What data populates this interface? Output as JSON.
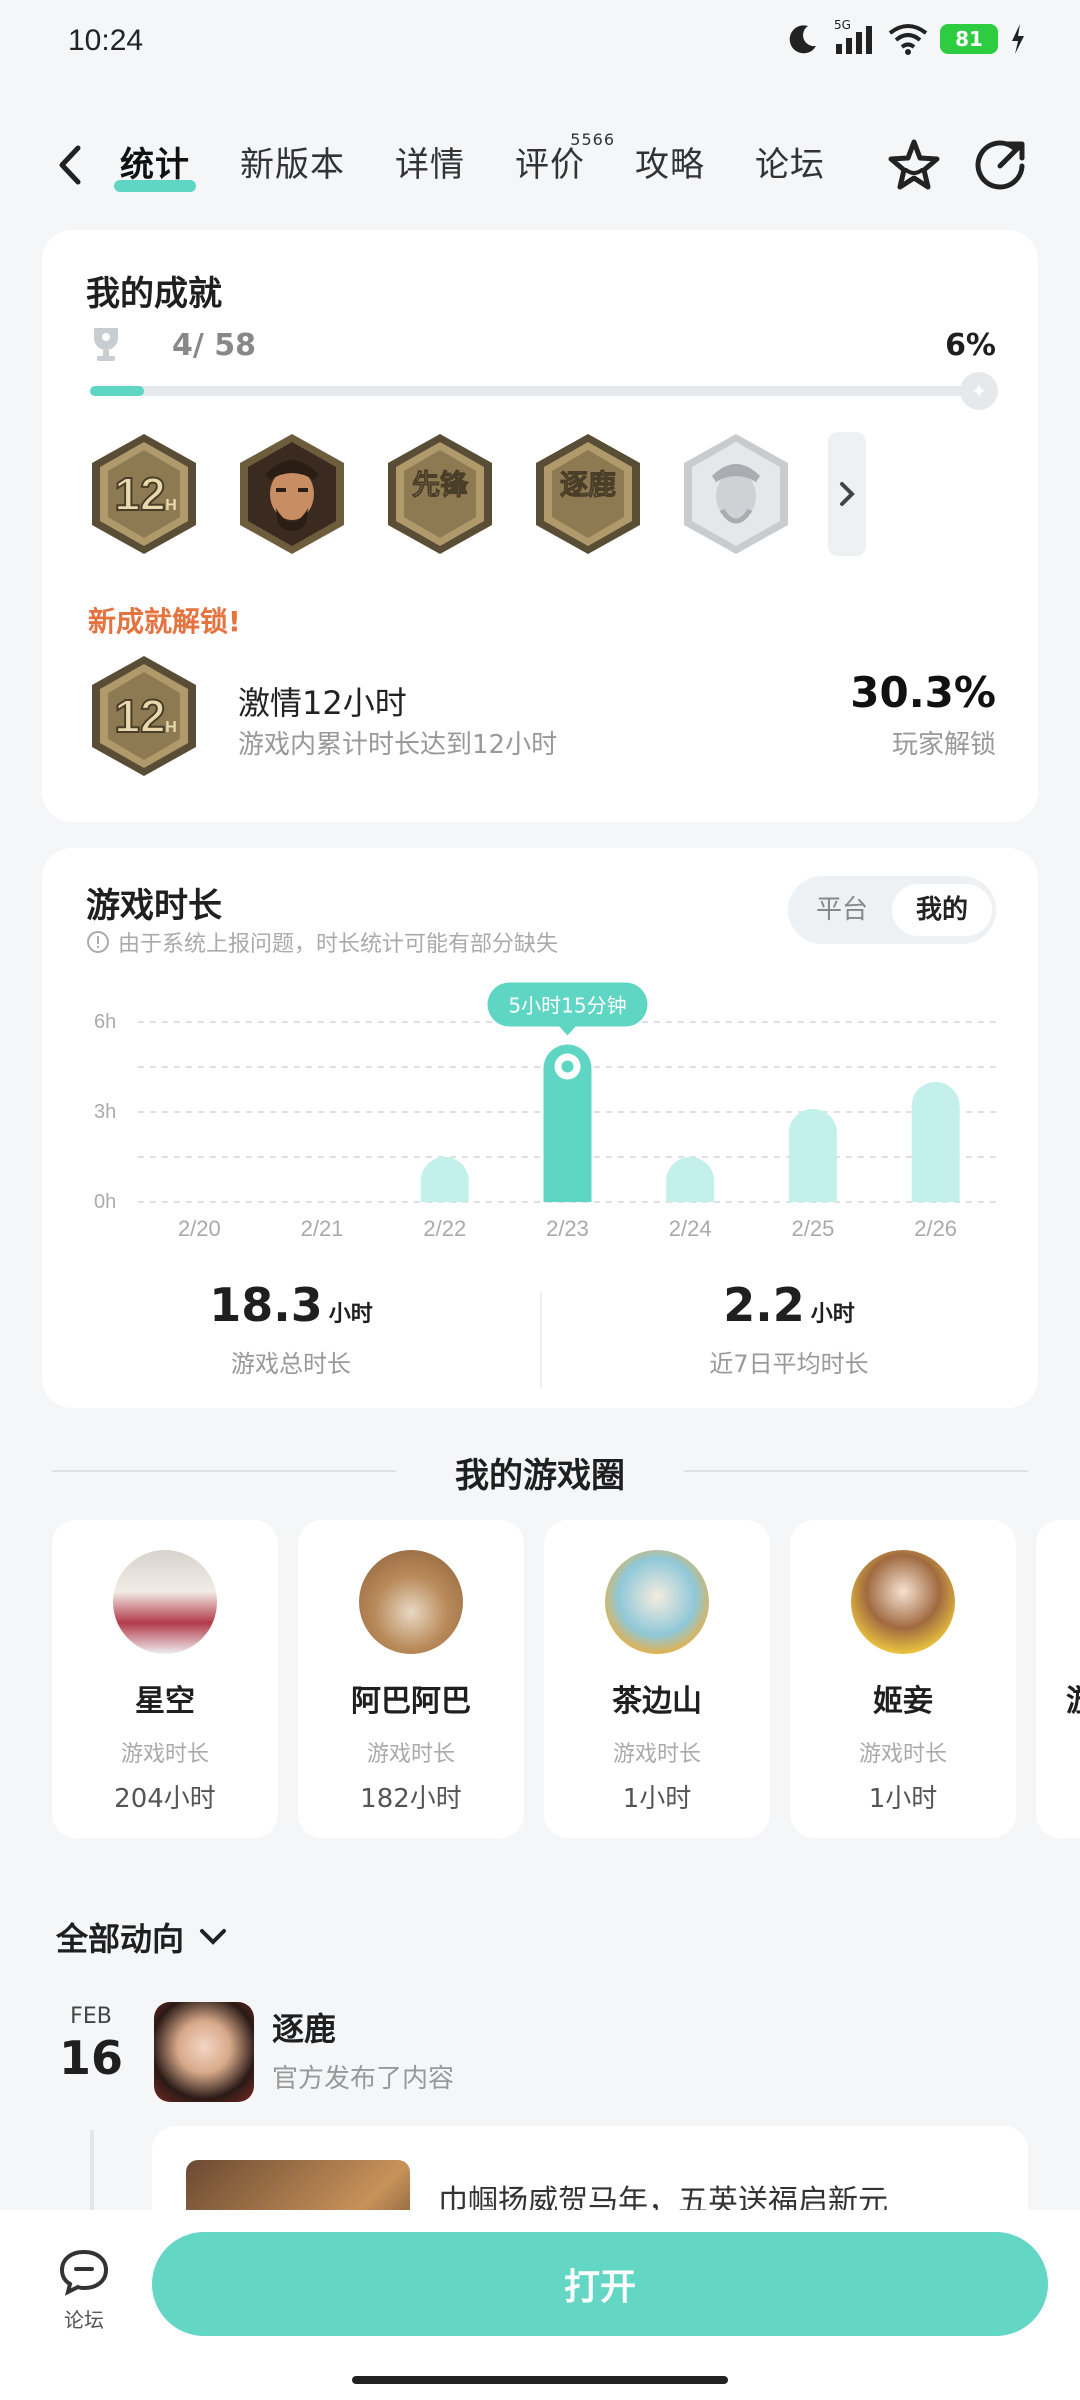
{
  "status": {
    "time": "10:24",
    "network": "5G",
    "battery": "81"
  },
  "header": {
    "tabs": [
      {
        "label": "统计"
      },
      {
        "label": "新版本"
      },
      {
        "label": "详情"
      },
      {
        "label": "评价",
        "count": "5566"
      },
      {
        "label": "攻略"
      },
      {
        "label": "论坛"
      }
    ]
  },
  "achievements": {
    "title": "我的成就",
    "count": "4/ 58",
    "percent": "6%",
    "progress": 0.06,
    "badges": [
      {
        "text": "12H",
        "style": "gold"
      },
      {
        "text": "",
        "style": "portrait"
      },
      {
        "text": "先锋",
        "style": "gold"
      },
      {
        "text": "逐鹿",
        "style": "gold"
      },
      {
        "text": "",
        "style": "locked"
      }
    ],
    "new_label": "新成就解锁!",
    "latest": {
      "badge_text": "12H",
      "name": "激情12小时",
      "desc": "游戏内累计时长达到12小时",
      "percent": "30.3%",
      "percent_label": "玩家解锁"
    }
  },
  "playtime": {
    "title": "游戏时长",
    "notice": "由于系统上报问题，时长统计可能有部分缺失",
    "segment": {
      "platform": "平台",
      "mine": "我的"
    },
    "total": {
      "value": "18.3",
      "unit": "小时",
      "label": "游戏总时长"
    },
    "average": {
      "value": "2.2",
      "unit": "小时",
      "label": "近7日平均时长"
    }
  },
  "chart_data": {
    "type": "bar",
    "categories": [
      "2/20",
      "2/21",
      "2/22",
      "2/23",
      "2/24",
      "2/25",
      "2/26"
    ],
    "values": [
      0,
      0,
      1.5,
      5.25,
      1.5,
      3.1,
      4.0
    ],
    "y_ticks": [
      "0h",
      "3h",
      "6h"
    ],
    "ylim": [
      0,
      6
    ],
    "highlight_index": 3,
    "highlight_label": "5小时15分钟",
    "colors": {
      "highlight": "#5fd6c3",
      "normal": "#c3f0ea"
    }
  },
  "circle": {
    "title": "我的游戏圈",
    "friends": [
      {
        "name": "星空",
        "label": "游戏时长",
        "value": "204小时",
        "avatar": "photo"
      },
      {
        "name": "阿巴阿巴",
        "label": "游戏时长",
        "value": "182小时",
        "avatar": "photo"
      },
      {
        "name": "茶边山",
        "label": "游戏时长",
        "value": "1小时",
        "avatar": "anime"
      },
      {
        "name": "姬妾",
        "label": "游戏时长",
        "value": "1小时",
        "avatar": "anime"
      }
    ],
    "partial_name": "游"
  },
  "feed": {
    "filter": "全部动向",
    "month": "FEB",
    "day": "16",
    "author": "逐鹿",
    "desc": "官方发布了内容",
    "post_text": "巾帼扬威贺马年，五英送福启新元"
  },
  "bottom": {
    "forum_label": "论坛",
    "open_label": "打开"
  }
}
